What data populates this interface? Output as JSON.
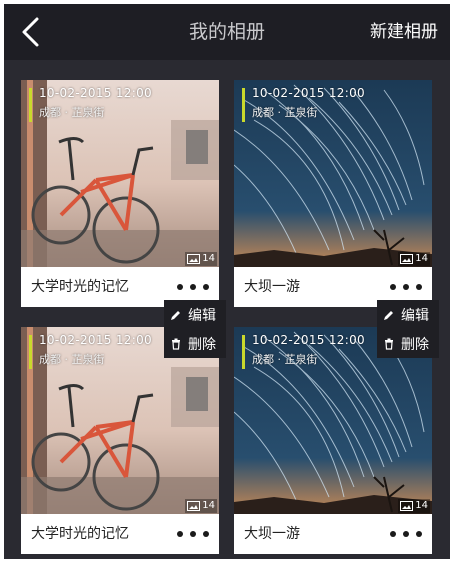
{
  "header": {
    "back_icon": "back-chevron-icon",
    "title": "我的相册",
    "action_label": "新建相册"
  },
  "albums": [
    {
      "date": "10-02-2015  12:00",
      "location": "成都 · 芷泉街",
      "count": "14",
      "title": "大学时光的记忆",
      "photo": "bicycle"
    },
    {
      "date": "10-02-2015  12:00",
      "location": "成都 · 芷泉街",
      "count": "14",
      "title": "大坝一游",
      "photo": "star-trails"
    },
    {
      "date": "10-02-2015  12:00",
      "location": "成都 · 芷泉街",
      "count": "14",
      "title": "大学时光的记忆",
      "photo": "bicycle"
    },
    {
      "date": "10-02-2015  12:00",
      "location": "成都 · 芷泉街",
      "count": "14",
      "title": "大坝一游",
      "photo": "star-trails"
    }
  ],
  "context_menu": {
    "edit_label": "编辑",
    "delete_label": "删除",
    "edit_icon": "pencil-icon",
    "delete_icon": "trash-icon"
  },
  "colors": {
    "accent": "#c9d92c",
    "nav_background": "#1e1e24",
    "page_background": "#2a2a31"
  }
}
